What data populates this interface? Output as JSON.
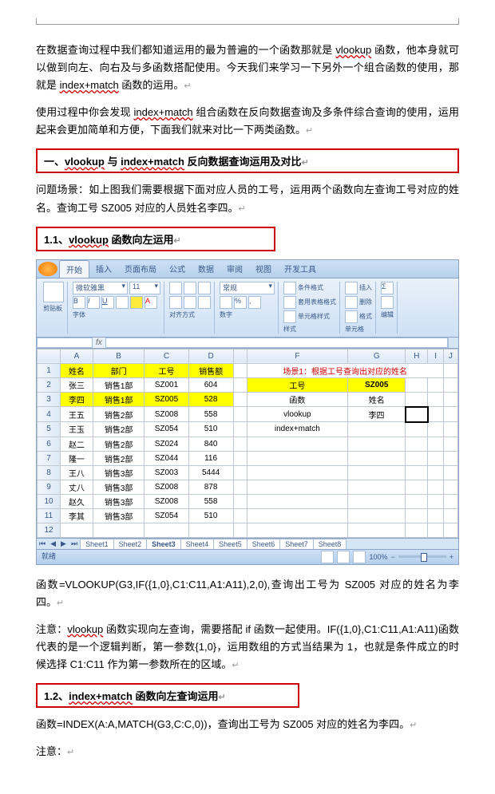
{
  "intro": {
    "p1a": "在数据查询过程中我们都知道运用的最为普遍的一个函数那就是 ",
    "p1_u": "vlookup",
    "p1b": " 函数，他本身就可以做到向左、向右及与多函数搭配使用。今天我们来学习一下另外一个组合函数的使用，那就是 ",
    "p1_u2": "index+match",
    "p1c": " 函数的运用。",
    "p2a": "使用过程中你会发现 ",
    "p2_u": "index+match",
    "p2b": " 组合函数在反向数据查询及多条件综合查询的使用，运用起来会更加简单和方便，下面我们就来对比一下两类函数。"
  },
  "h1": {
    "pre": "一、",
    "u1": "vlookup",
    "mid": " 与 ",
    "u2": "index+match",
    "post": " 反向数据查询运用及对比"
  },
  "scene": "问题场景：如上图我们需要根据下面对应人员的工号，运用两个函数向左查询工号对应的姓名。查询工号 SZ005 对应的人员姓名李四。",
  "h11": {
    "pre": "1.1、",
    "u": "vlookup",
    "post": " 函数向左运用"
  },
  "excel": {
    "font": "微软雅黑",
    "size": "11",
    "r_tabs": [
      "开始",
      "插入",
      "页面布局",
      "公式",
      "数据",
      "审阅",
      "视图",
      "开发工具"
    ],
    "tg_labels": [
      "剪贴板",
      "字体",
      "对齐方式",
      "数字",
      "样式",
      "单元格",
      "编辑"
    ],
    "tg_items": {
      "cond": "条件格式",
      "tbl": "套用表格格式",
      "cell": "单元格样式",
      "ins": "插入",
      "del": "删除",
      "fmt": "格式"
    },
    "cols": [
      "A",
      "B",
      "C",
      "D",
      "E",
      "F",
      "G",
      "H",
      "I",
      "J"
    ],
    "hdr": [
      "姓名",
      "部门",
      "工号",
      "销售额"
    ],
    "rows": [
      [
        "张三",
        "销售1部",
        "SZ001",
        "604"
      ],
      [
        "李四",
        "销售1部",
        "SZ005",
        "528"
      ],
      [
        "王五",
        "销售2部",
        "SZ008",
        "558"
      ],
      [
        "王玉",
        "销售2部",
        "SZ054",
        "510"
      ],
      [
        "赵二",
        "销售2部",
        "SZ024",
        "840"
      ],
      [
        "隆一",
        "销售2部",
        "SZ044",
        "116"
      ],
      [
        "王八",
        "销售3部",
        "SZ003",
        "5444"
      ],
      [
        "丈八",
        "销售3部",
        "SZ008",
        "878"
      ],
      [
        "赵久",
        "销售3部",
        "SZ008",
        "558"
      ],
      [
        "李其",
        "销售3部",
        "SZ054",
        "510"
      ]
    ],
    "lookup": {
      "title": "场景1：根据工号查询出对应的姓名",
      "h1": "工号",
      "h2": "SZ005",
      "r1": "函数",
      "r2": "姓名",
      "r3": "vlookup",
      "r4": "李四",
      "r5": "index+match",
      "r6": ""
    },
    "sheets": [
      "Sheet1",
      "Sheet2",
      "Sheet3",
      "Sheet4",
      "Sheet5",
      "Sheet6",
      "Sheet7",
      "Sheet8"
    ],
    "status": "就绪",
    "zoom": "100%"
  },
  "formula1": "函数=VLOOKUP(G3,IF({1,0},C1:C11,A1:A11),2,0),查询出工号为 SZ005 对应的姓名为李四。",
  "note1": {
    "pre": "注意：",
    "u": "vlookup",
    "post": " 函数实现向左查询，需要搭配 if 函数一起使用。IF({1,0},C1:C11,A1:A11)函数代表的是一个逻辑判断，第一参数{1,0}，运用数组的方式当结果为 1，也就是条件成立的时候选择 C1:C11 作为第一参数所在的区域。"
  },
  "h12": {
    "pre": "1.2、",
    "u": "index+match",
    "post": " 函数向左查询运用"
  },
  "formula2": "函数=INDEX(A:A,MATCH(G3,C:C,0))，查询出工号为 SZ005 对应的姓名为李四。",
  "note2": "注意："
}
